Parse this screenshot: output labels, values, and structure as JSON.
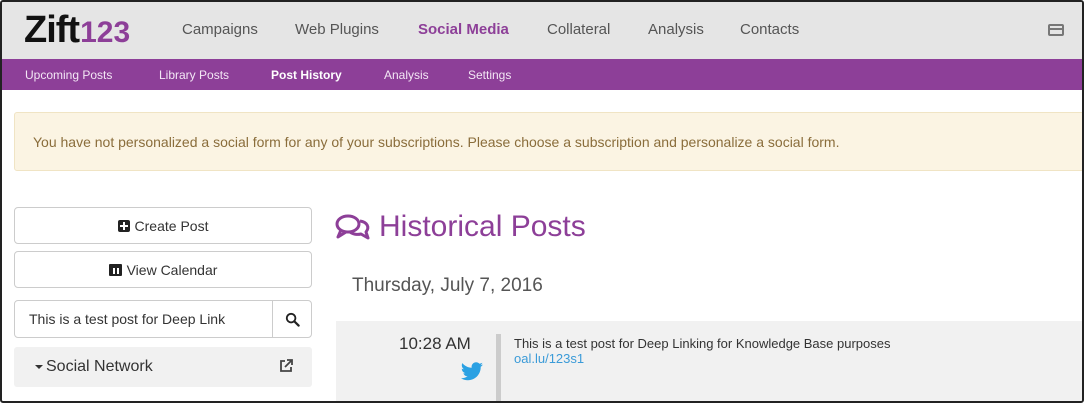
{
  "logo": {
    "word": "Zift",
    "number": "123"
  },
  "top_nav": {
    "items": [
      "Campaigns",
      "Web Plugins",
      "Social Media",
      "Collateral",
      "Analysis",
      "Contacts"
    ],
    "active": "Social Media"
  },
  "sub_nav": {
    "items": [
      "Upcoming Posts",
      "Library Posts",
      "Post History",
      "Analysis",
      "Settings"
    ],
    "active": "Post History"
  },
  "alert": {
    "message": "You have not personalized a social form for any of your subscriptions. Please choose a subscription and personalize a social form."
  },
  "sidebar": {
    "create_post_label": "Create Post",
    "view_calendar_label": "View Calendar",
    "search_value": "This is a test post for Deep Link",
    "social_network_label": "Social Network"
  },
  "main": {
    "title": "Historical Posts",
    "date": "Thursday, July 7, 2016",
    "post": {
      "time": "10:28 AM",
      "network_icon": "twitter-icon",
      "text": "This is a test post for Deep Linking for Knowledge Base purposes",
      "link": "oal.lu/123s1"
    }
  },
  "colors": {
    "brand_purple": "#8d3f98",
    "link_blue": "#3b9bd8",
    "alert_bg": "#fbf4e3",
    "alert_text": "#8a6d3b"
  }
}
